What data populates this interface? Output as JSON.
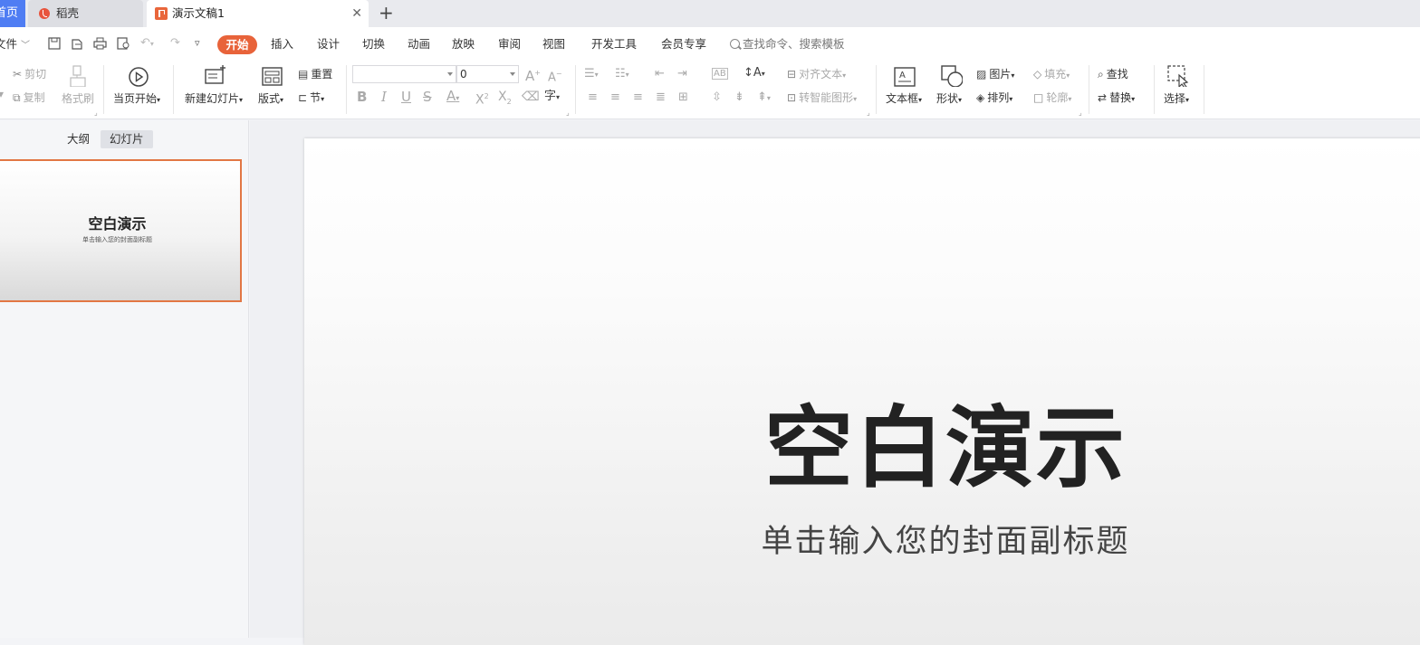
{
  "tabs": {
    "home_label": "首页",
    "daoke_label": "稻壳",
    "doc_label": "演示文稿1",
    "close_glyph": "✕",
    "add_glyph": "+"
  },
  "menu": {
    "file": "文件",
    "items": [
      "开始",
      "插入",
      "设计",
      "切换",
      "动画",
      "放映",
      "审阅",
      "视图",
      "开发工具",
      "会员专享"
    ],
    "search_placeholder": "查找命令、搜索模板"
  },
  "ribbon": {
    "cut": "剪切",
    "copy": "复制",
    "format_painter": "格式刷",
    "from_current": "当页开始",
    "new_slide": "新建幻灯片",
    "layout": "版式",
    "reset": "重置",
    "section": "节",
    "font_name": "",
    "font_size": "0",
    "align_text": "对齐文本",
    "smartart": "转智能图形",
    "textbox": "文本框",
    "shape": "形状",
    "picture": "图片",
    "arrange": "排列",
    "fill": "填充",
    "outline": "轮廓",
    "find": "查找",
    "replace": "替换",
    "select": "选择"
  },
  "left_pane": {
    "outline_tab": "大纲",
    "slides_tab": "幻灯片",
    "thumb_title": "空白演示",
    "thumb_subtitle": "单击输入您的封面副标题"
  },
  "slide": {
    "title": "空白演示",
    "subtitle": "单击输入您的封面副标题"
  },
  "colors": {
    "accent": "#e8633a",
    "home_tab": "#4f7df3",
    "selection_border": "#e27744"
  }
}
